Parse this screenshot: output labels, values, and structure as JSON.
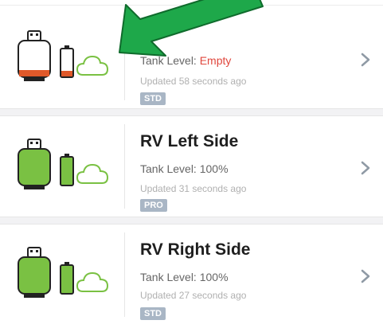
{
  "tanks": [
    {
      "name": "",
      "level_label": "Tank Level: ",
      "level_value": "Empty",
      "updated": "Updated 58 seconds ago",
      "badge": "STD",
      "fill": 0
    },
    {
      "name": "RV Left Side",
      "level_label": "Tank Level: ",
      "level_value": "100%",
      "updated": "Updated 31 seconds ago",
      "badge": "PRO",
      "fill": 100
    },
    {
      "name": "RV Right Side",
      "level_label": "Tank Level: ",
      "level_value": "100%",
      "updated": "Updated 27 seconds ago",
      "badge": "STD",
      "fill": 100
    }
  ],
  "colors": {
    "full": "#7ac143",
    "empty_accent": "#e0592a",
    "empty_text": "#e0473d",
    "arrow": "#1ea84a",
    "badge": "#a9b6c5"
  },
  "icons": [
    "propane-tank-icon",
    "battery-icon",
    "cloud-icon",
    "chevron-right-icon",
    "annotation-arrow-icon"
  ]
}
